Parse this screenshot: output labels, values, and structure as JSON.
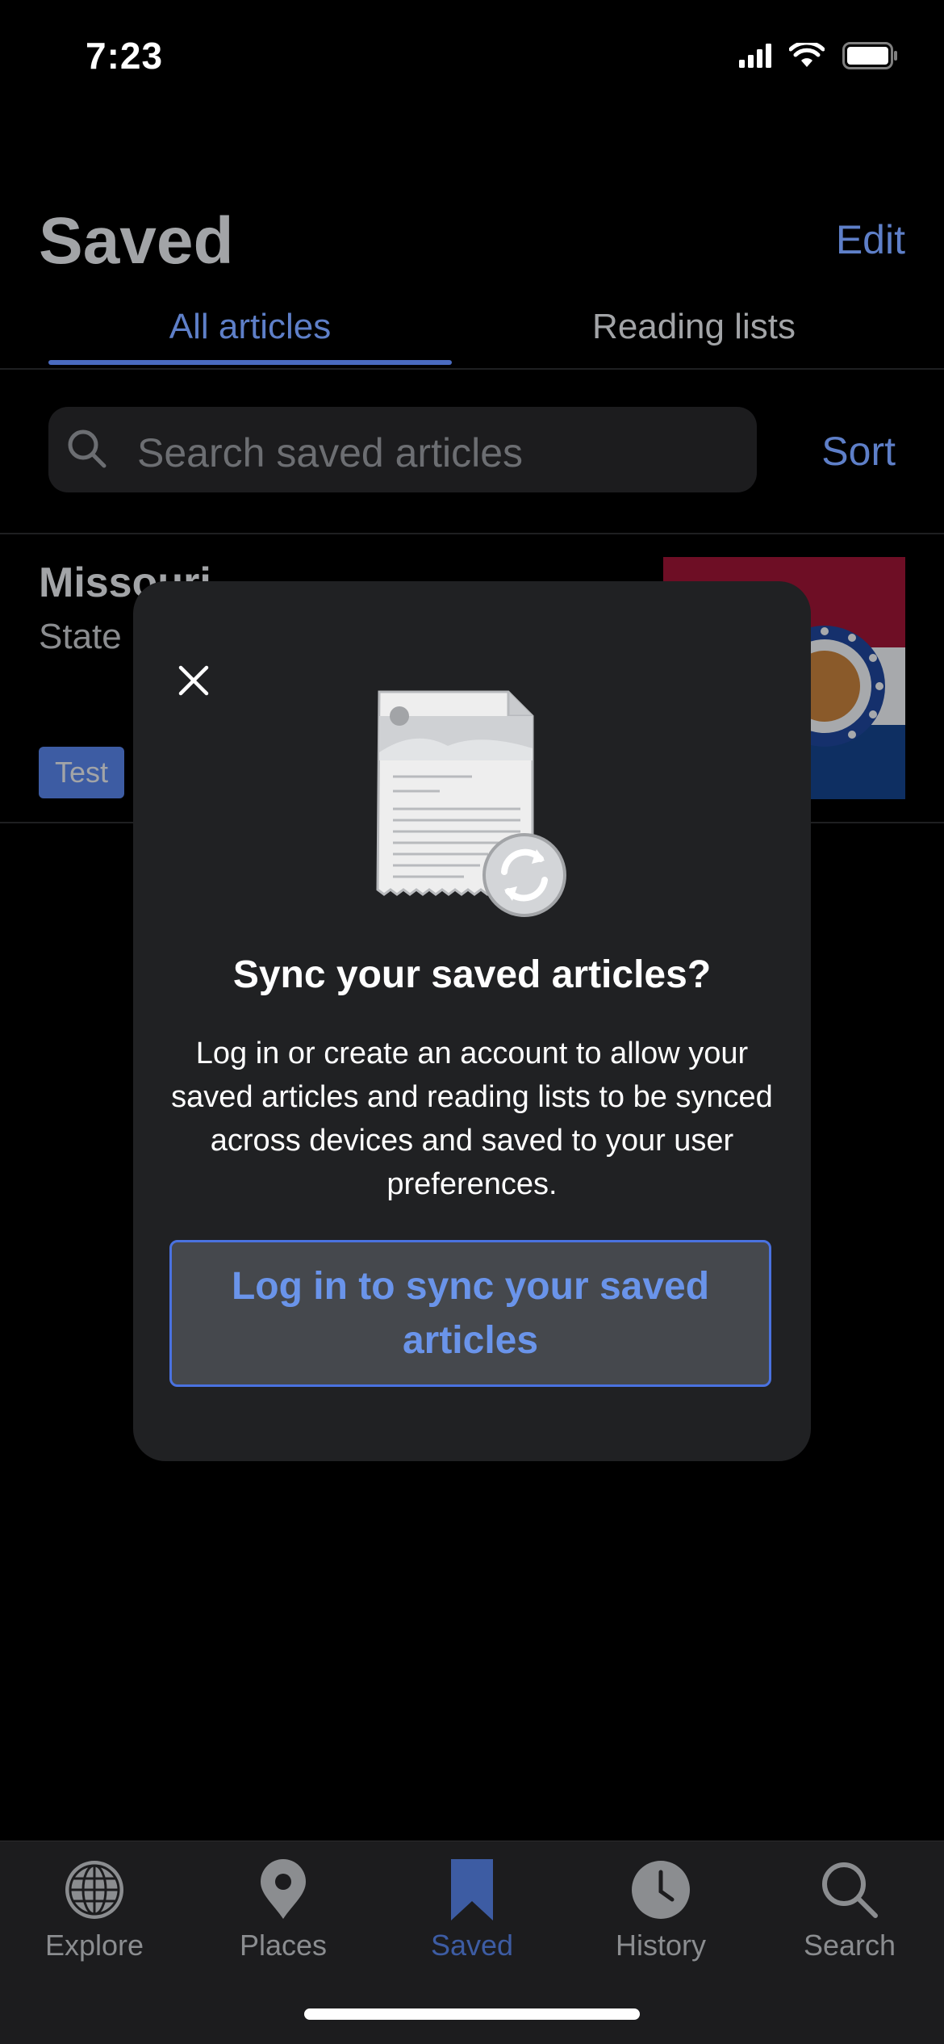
{
  "status_bar": {
    "time": "7:23"
  },
  "header": {
    "title": "Saved",
    "edit_label": "Edit"
  },
  "tabs": [
    {
      "label": "All articles",
      "active": true
    },
    {
      "label": "Reading lists",
      "active": false
    }
  ],
  "search": {
    "placeholder": "Search saved articles",
    "sort_label": "Sort"
  },
  "article": {
    "title": "Missouri",
    "description": "State",
    "tag": "Test",
    "thumbnail": "flag-of-missouri"
  },
  "modal": {
    "title": "Sync your saved articles?",
    "body": "Log in or create an account to allow your saved articles and reading lists to be synced across devices and saved to your user preferences.",
    "button_label": "Log in to sync your saved articles",
    "illustration": "document-sync-icon"
  },
  "tab_bar": {
    "items": [
      {
        "label": "Explore",
        "icon": "globe-icon",
        "active": false
      },
      {
        "label": "Places",
        "icon": "map-pin-icon",
        "active": false
      },
      {
        "label": "Saved",
        "icon": "bookmark-icon",
        "active": true
      },
      {
        "label": "History",
        "icon": "clock-icon",
        "active": false
      },
      {
        "label": "Search",
        "icon": "search-icon",
        "active": false
      }
    ]
  },
  "colors": {
    "accent": "#5e7fc8",
    "active_tab": "#3d5ca3",
    "modal_bg": "#202123",
    "button_border": "#4a72e0",
    "button_text": "#6a94ea"
  }
}
